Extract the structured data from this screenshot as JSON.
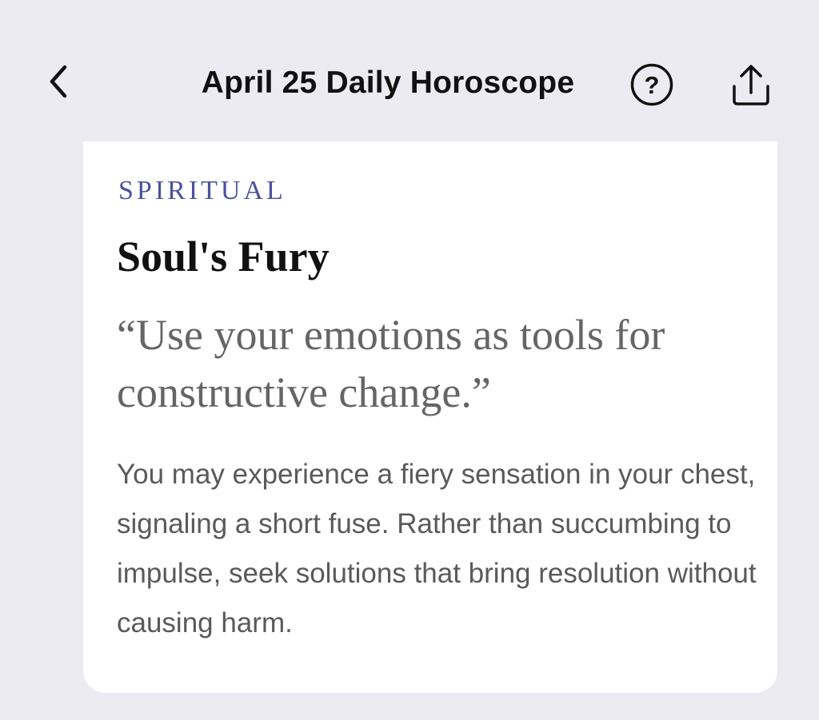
{
  "header": {
    "title": "April 25 Daily Horoscope",
    "back_icon": "chevron-left-icon",
    "help_icon": "question-circle-icon",
    "help_glyph": "?",
    "share_icon": "share-upload-icon"
  },
  "card": {
    "category": "SPIRITUAL",
    "title": "Soul's Fury",
    "quote": "“Use your emotions as tools for constructive change.”",
    "body": "You may experience a fiery sensation in your chest, signaling a short fuse. Rather than succumbing to impulse, seek solutions that bring resolution without causing harm."
  },
  "colors": {
    "background": "#edebf2",
    "card": "#ffffff",
    "accent": "#4c519d",
    "title": "#111111",
    "quote": "#656565",
    "body": "#5a5a5a"
  }
}
